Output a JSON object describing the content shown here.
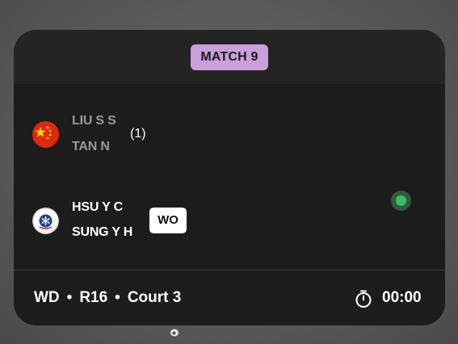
{
  "match": {
    "label": "MATCH 9"
  },
  "team1": {
    "flag_icon": "china-flag-icon",
    "players": [
      "LIU S S",
      "TAN N"
    ],
    "seed": "(1)"
  },
  "team2": {
    "flag_icon": "chinese-taipei-flag-icon",
    "players": [
      "HSU Y C",
      "SUNG Y H"
    ],
    "result_badge": "WO"
  },
  "footer": {
    "event": "WD",
    "round": "R16",
    "court": "Court 3",
    "separator": "•",
    "timer_icon": "stopwatch-icon",
    "time": "00:00"
  },
  "colors": {
    "badge_purple": "#c9a0dc",
    "live_green": "#3dbb6a",
    "card_bg": "#1c1c1c"
  }
}
